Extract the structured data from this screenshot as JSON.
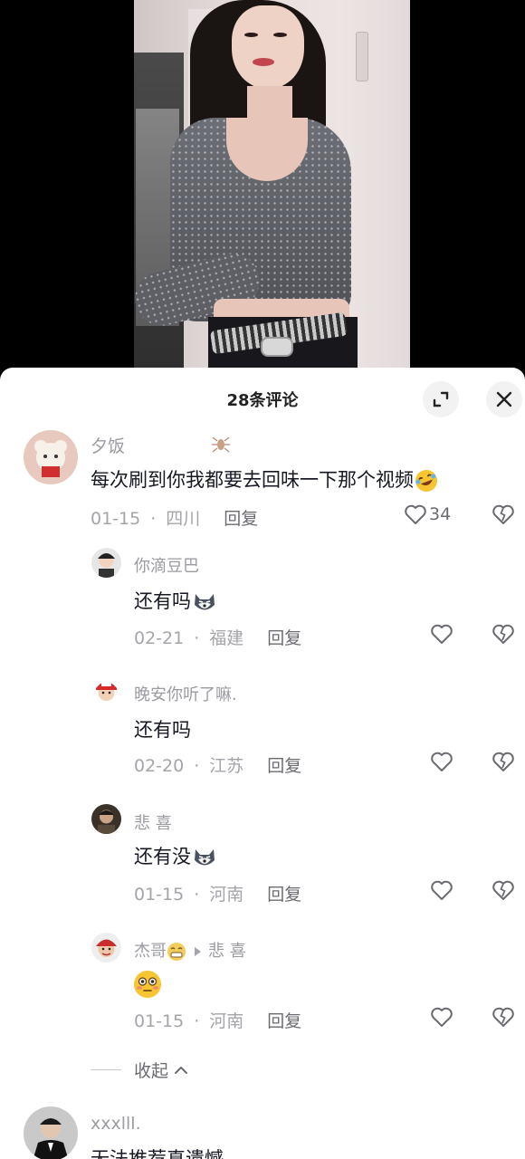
{
  "header": {
    "title": "28条评论",
    "expand_icon": "expand-icon",
    "close_icon": "close-icon"
  },
  "comments": [
    {
      "nickname": "夕饭",
      "text": "每次刷到你我都要去回味一下那个视频",
      "text_emoji": "rofl-emoji",
      "date": "01-15",
      "location": "四川",
      "reply_label": "回复",
      "like_count": "34"
    }
  ],
  "replies": [
    {
      "nickname": "你滴豆巴",
      "text": "还有吗",
      "text_emoji": "husky-emoji",
      "date": "02-21",
      "location": "福建",
      "reply_label": "回复"
    },
    {
      "nickname": "晚安你听了嘛.",
      "text": "还有吗",
      "date": "02-20",
      "location": "江苏",
      "reply_label": "回复"
    },
    {
      "nickname": "悲 喜",
      "text": "还有没",
      "text_emoji": "husky-emoji",
      "date": "01-15",
      "location": "河南",
      "reply_label": "回复"
    },
    {
      "nickname": "杰哥",
      "nickname_emoji": "grin-emoji",
      "reply_to": "悲 喜",
      "text_emoji": "flushed-emoji",
      "date": "01-15",
      "location": "河南",
      "reply_label": "回复"
    }
  ],
  "collapse_label": "收起",
  "next_comment": {
    "nickname": "xxxlll.",
    "text": "无法推荐真遗憾"
  },
  "colors": {
    "text": "#161823",
    "meta": "#a4a4aa",
    "accent_red": "#c2454d"
  }
}
